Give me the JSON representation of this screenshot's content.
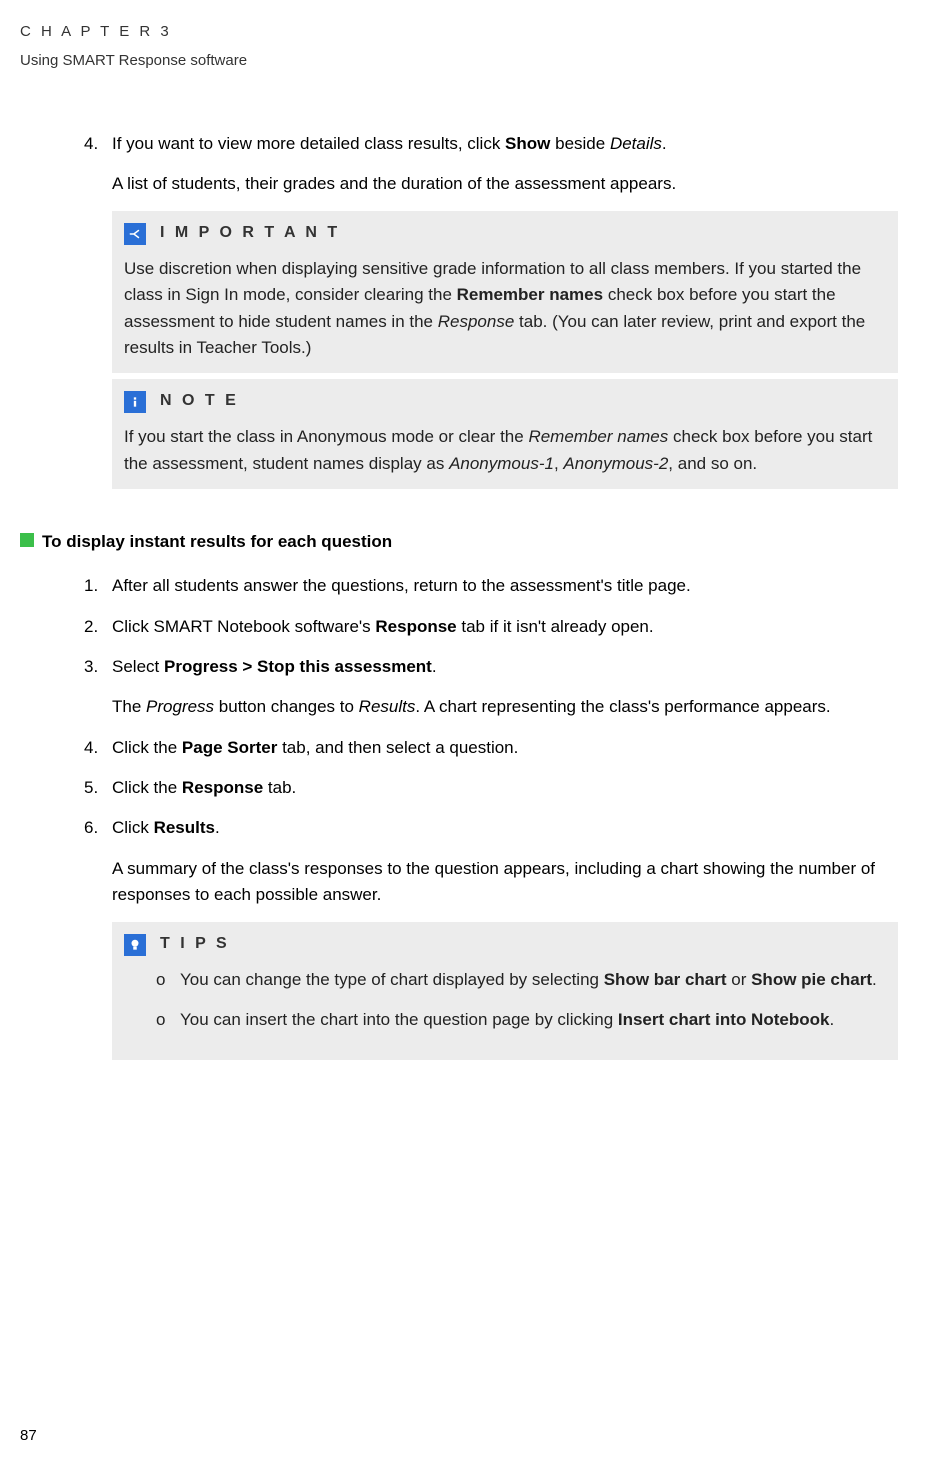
{
  "header": {
    "chapter_line": "C H A P T E R   3",
    "subtitle": "Using SMART Response software"
  },
  "step4": {
    "num": "4.",
    "p1_a": "If you want to view more detailed class results, click ",
    "p1_b": "Show",
    "p1_c": " beside ",
    "p1_d": "Details",
    "p1_e": ".",
    "p2": "A list of students, their grades and the duration of the assessment appears."
  },
  "important": {
    "title": "I M P O R T A N T",
    "b1": "Use discretion when displaying sensitive grade information to all class members. If you started the class in Sign In mode, consider clearing the ",
    "b2": "Remember names",
    "b3": " check box before you start the assessment to hide student names in the ",
    "b4": "Response",
    "b5": " tab. (You can later review, print and export the results in Teacher Tools.)"
  },
  "note": {
    "title": "N O T E",
    "b1": "If you start the class in Anonymous mode or clear the ",
    "b2": "Remember names",
    "b3": " check box before you start the assessment, student names display as ",
    "b4": "Anonymous-1",
    "b5": ", ",
    "b6": "Anonymous-2",
    "b7": ", and so on."
  },
  "section2": {
    "heading": "To display instant results for each question",
    "s1": {
      "num": "1.",
      "t": "After all students answer the questions, return to the assessment's title page."
    },
    "s2": {
      "num": "2.",
      "a": "Click SMART Notebook software's ",
      "b": "Response",
      "c": " tab if it isn't already open."
    },
    "s3": {
      "num": "3.",
      "a": "Select ",
      "b": "Progress > Stop this assessment",
      "c": ".",
      "p2a": "The ",
      "p2b": "Progress",
      "p2c": " button changes to ",
      "p2d": "Results",
      "p2e": ". A chart representing the class's performance appears."
    },
    "s4": {
      "num": "4.",
      "a": "Click the ",
      "b": "Page Sorter",
      "c": " tab, and then select a question."
    },
    "s5": {
      "num": "5.",
      "a": "Click the ",
      "b": "Response",
      "c": " tab."
    },
    "s6": {
      "num": "6.",
      "a": "Click ",
      "b": "Results",
      "c": ".",
      "p2": "A summary of the class's responses to the question appears, including a chart showing the number of responses to each possible answer."
    }
  },
  "tips": {
    "title": "T I P S",
    "t1a": "You can change the type of chart displayed by selecting ",
    "t1b": "Show bar chart",
    "t1c": " or ",
    "t1d": "Show pie chart",
    "t1e": ".",
    "t2a": "You can insert the chart into the question page by clicking ",
    "t2b": "Insert chart into Notebook",
    "t2c": ".",
    "bullet": "o"
  },
  "pageNum": "87"
}
